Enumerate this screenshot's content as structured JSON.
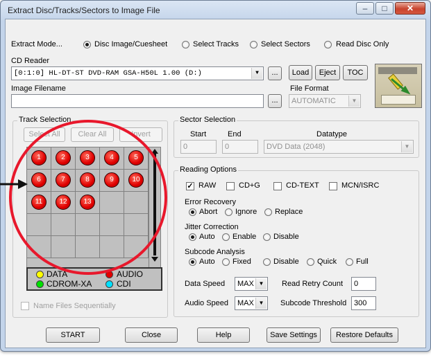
{
  "window": {
    "title": "Extract Disc/Tracks/Sectors to Image File"
  },
  "extract_mode": {
    "label": "Extract Mode...",
    "options": [
      "Disc Image/Cuesheet",
      "Select Tracks",
      "Select Sectors",
      "Read Disc Only"
    ],
    "selected": "Disc Image/Cuesheet"
  },
  "cd_reader": {
    "label": "CD Reader",
    "value": "[0:1:0] HL-DT-ST DVD-RAM GSA-H50L 1.00 (D:)",
    "browse": "...",
    "load": "Load",
    "eject": "Eject",
    "toc": "TOC"
  },
  "image_filename": {
    "label": "Image Filename",
    "value": "",
    "browse": "..."
  },
  "file_format": {
    "label": "File Format",
    "value": "AUTOMATIC"
  },
  "track_selection": {
    "title": "Track Selection",
    "select_all": "Select All",
    "clear_all": "Clear All",
    "invert": "Invert",
    "tracks": [
      "1",
      "2",
      "3",
      "4",
      "5",
      "6",
      "7",
      "8",
      "9",
      "10",
      "11",
      "12",
      "13"
    ],
    "legend": {
      "data": "DATA",
      "audio": "AUDIO",
      "cdrom_xa": "CDROM-XA",
      "cdi": "CDI"
    },
    "name_files_sequentially": "Name Files Sequentially"
  },
  "sector_selection": {
    "title": "Sector Selection",
    "start_label": "Start",
    "end_label": "End",
    "datatype_label": "Datatype",
    "start": "0",
    "end": "0",
    "datatype": "DVD Data (2048)"
  },
  "reading_options": {
    "title": "Reading Options",
    "raw": "RAW",
    "cdg": "CD+G",
    "cdtext": "CD-TEXT",
    "mcn": "MCN/ISRC",
    "error_recovery": {
      "label": "Error Recovery",
      "options": [
        "Abort",
        "Ignore",
        "Replace"
      ],
      "selected": "Abort"
    },
    "jitter": {
      "label": "Jitter Correction",
      "options": [
        "Auto",
        "Enable",
        "Disable"
      ],
      "selected": "Auto"
    },
    "subcode": {
      "label": "Subcode Analysis",
      "options": [
        "Auto",
        "Fixed",
        "Disable",
        "Quick",
        "Full"
      ],
      "selected": "Auto"
    },
    "data_speed_label": "Data Speed",
    "data_speed": "MAX",
    "audio_speed_label": "Audio Speed",
    "audio_speed": "MAX",
    "read_retry_label": "Read Retry Count",
    "read_retry": "0",
    "subcode_threshold_label": "Subcode Threshold",
    "subcode_threshold": "300"
  },
  "footer": {
    "start": "START",
    "close": "Close",
    "help": "Help",
    "save": "Save Settings",
    "restore": "Restore Defaults"
  },
  "colors": {
    "annotation": "#e8182c",
    "track": "#e00000",
    "data": "#ffff00",
    "cdrom_xa": "#00e000",
    "cdi": "#00e0ff"
  }
}
